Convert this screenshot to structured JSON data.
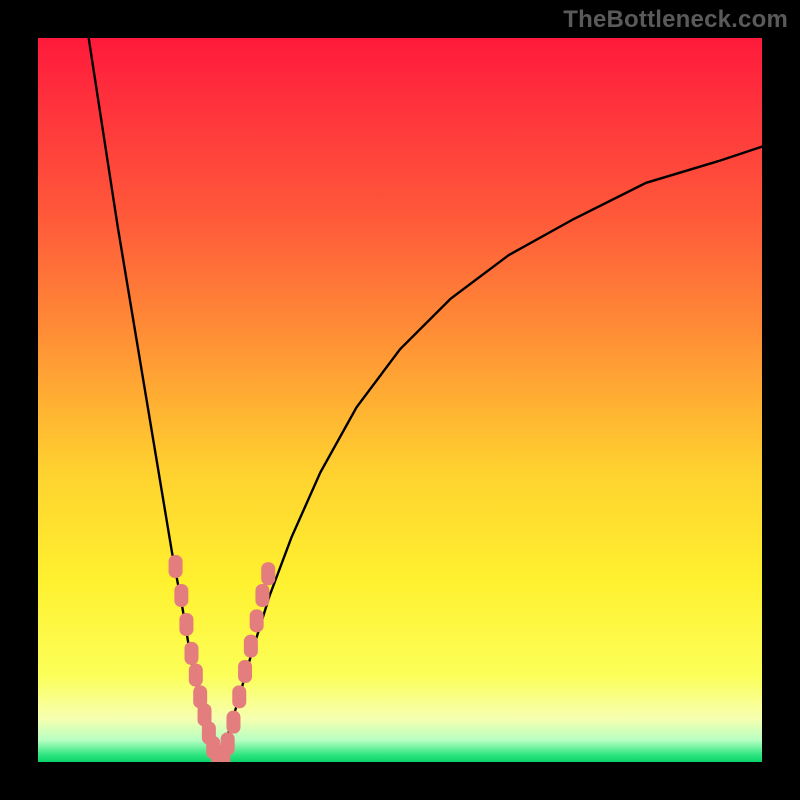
{
  "watermark": "TheBottleneck.com",
  "colors": {
    "curve_stroke": "#000000",
    "marker_fill": "#e47d7d",
    "marker_stroke": "#e47d7d",
    "frame": "#000000"
  },
  "chart_data": {
    "type": "line",
    "title": "",
    "xlabel": "",
    "ylabel": "",
    "xlim": [
      0,
      100
    ],
    "ylim": [
      0,
      100
    ],
    "note": "No axis ticks or numeric labels are visible; x/y values are estimated in percentage of plot area. y represents height of curve (distance from bottom edge), bottom = 0.",
    "series": [
      {
        "name": "left-curve",
        "x": [
          7,
          9,
          11,
          13,
          15,
          17,
          18.5,
          20,
          21,
          22,
          23,
          24,
          24.8
        ],
        "y": [
          100,
          87,
          74,
          62,
          50,
          38,
          29,
          21,
          15,
          10,
          6,
          3,
          0.5
        ]
      },
      {
        "name": "right-curve",
        "x": [
          25.2,
          26,
          27.5,
          29.5,
          32,
          35,
          39,
          44,
          50,
          57,
          65,
          74,
          84,
          94,
          100
        ],
        "y": [
          0.5,
          3,
          8,
          15,
          23,
          31,
          40,
          49,
          57,
          64,
          70,
          75,
          80,
          83,
          85
        ]
      }
    ],
    "markers": {
      "name": "scatter-points",
      "note": "Pink lozenge markers clustered near the valley on both branches, in the lower ~30% of the plot.",
      "points": [
        {
          "x": 19.0,
          "y": 27
        },
        {
          "x": 19.8,
          "y": 23
        },
        {
          "x": 20.5,
          "y": 19
        },
        {
          "x": 21.2,
          "y": 15
        },
        {
          "x": 21.8,
          "y": 12
        },
        {
          "x": 22.4,
          "y": 9
        },
        {
          "x": 23.0,
          "y": 6.5
        },
        {
          "x": 23.6,
          "y": 4
        },
        {
          "x": 24.2,
          "y": 2
        },
        {
          "x": 24.9,
          "y": 0.8
        },
        {
          "x": 25.6,
          "y": 0.8
        },
        {
          "x": 26.2,
          "y": 2.5
        },
        {
          "x": 27.0,
          "y": 5.5
        },
        {
          "x": 27.8,
          "y": 9
        },
        {
          "x": 28.6,
          "y": 12.5
        },
        {
          "x": 29.4,
          "y": 16
        },
        {
          "x": 30.2,
          "y": 19.5
        },
        {
          "x": 31.0,
          "y": 23
        },
        {
          "x": 31.8,
          "y": 26
        }
      ]
    }
  }
}
